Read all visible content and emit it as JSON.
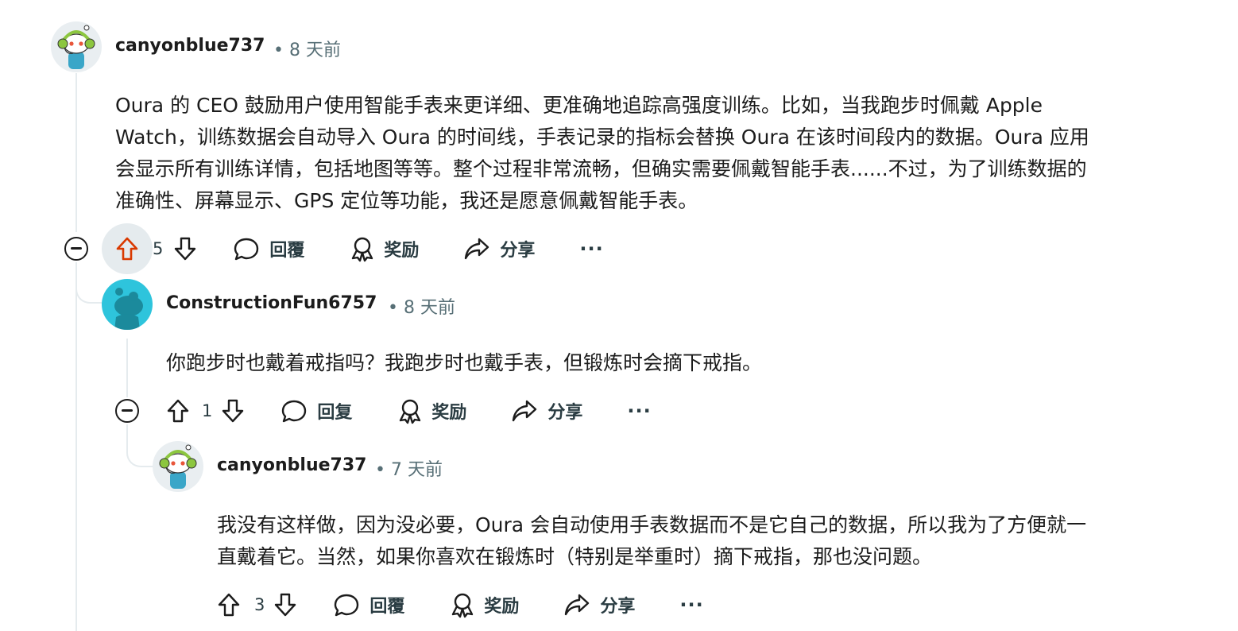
{
  "comments": [
    {
      "username": "canyonblue737",
      "time": "• 8 天前",
      "text_lines": [
        "Oura 的 CEO 鼓励用户使用智能手表来更详细、更准确地追踪高强度训练。比如，当我跑步时佩戴 Apple",
        "Watch，训练数据会自动导入 Oura 的时间线，手表记录的指标会替换 Oura 在该时间段内的数据。Oura 应用",
        "会显示所有训练详情，包括地图等等。整个过程非常流畅，但确实需要佩戴智能手表......不过，为了训练数据的",
        "准确性、屏幕显示、GPS 定位等功能，我还是愿意佩戴智能手表。"
      ],
      "score": "5",
      "reply_label": "回覆",
      "award_label": "奖励",
      "share_label": "分享",
      "more_label": "···"
    },
    {
      "username": "ConstructionFun6757",
      "time": "• 8 天前",
      "text_lines": [
        "你跑步时也戴着戒指吗？我跑步时也戴手表，但锻炼时会摘下戒指。"
      ],
      "score": "1",
      "reply_label": "回复",
      "award_label": "奖励",
      "share_label": "分享",
      "more_label": "···"
    },
    {
      "username": "canyonblue737",
      "time": "• 7 天前",
      "text_lines": [
        "我没有这样做，因为没必要，Oura 会自动使用手表数据而不是它自己的数据，所以我为了方便就一",
        "直戴着它。当然，如果你喜欢在锻炼时（特别是举重时）摘下戒指，那也没问题。"
      ],
      "score": "3",
      "reply_label": "回覆",
      "award_label": "奖励",
      "share_label": "分享",
      "more_label": "···"
    }
  ],
  "colors": {
    "upvoted": "#d93900",
    "meta": "#576f76",
    "thread_line": "#e5ebee",
    "avatar_teal": "#2ec4dc"
  }
}
